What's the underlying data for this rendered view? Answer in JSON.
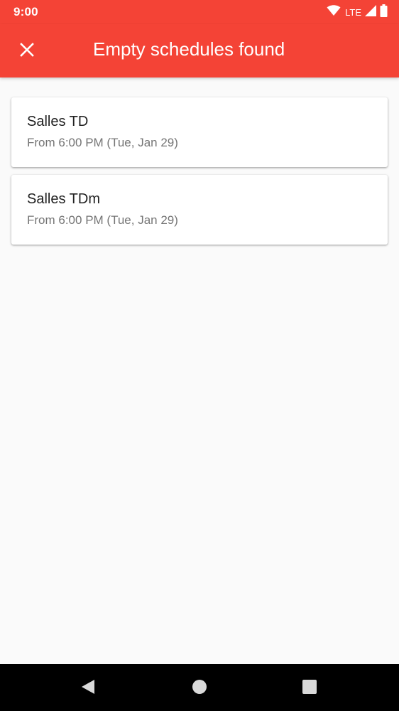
{
  "status_bar": {
    "time": "9:00",
    "network": "LTE",
    "icons": [
      "wifi-icon",
      "signal-icon",
      "battery-icon"
    ]
  },
  "app_bar": {
    "title": "Empty schedules found",
    "close_icon": "close-icon",
    "color": "#f44336"
  },
  "schedules": [
    {
      "name": "Salles TD",
      "subtitle": "From 6:00 PM (Tue, Jan 29)"
    },
    {
      "name": "Salles TDm",
      "subtitle": "From 6:00 PM (Tue, Jan 29)"
    }
  ],
  "nav_bar": {
    "icons": [
      "back-icon",
      "home-icon",
      "recents-icon"
    ]
  }
}
